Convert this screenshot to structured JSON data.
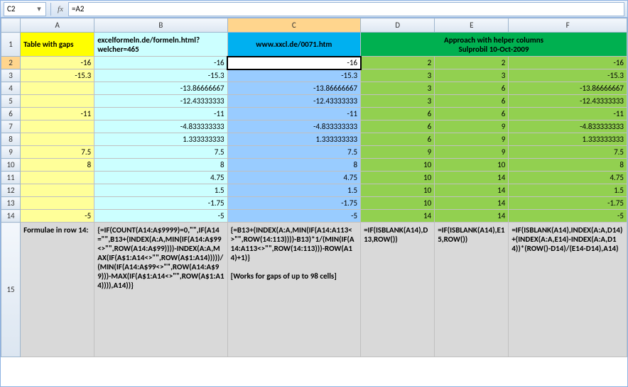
{
  "nameBox": "C2",
  "formula": "=A2",
  "fxLabel": "fx",
  "columns": [
    "A",
    "B",
    "C",
    "D",
    "E",
    "F"
  ],
  "rowNumbers": [
    1,
    2,
    3,
    4,
    5,
    6,
    7,
    8,
    9,
    10,
    11,
    12,
    13,
    14,
    15
  ],
  "selectedCell": "C2",
  "header": {
    "A": "Table with gaps",
    "B": "excelformeln.de/formeln.html?welcher=465",
    "C": "www.xxcl.de/0071.htm",
    "DEF1": "Approach with helper columns",
    "DEF2": "Sulprobil 10-Oct-2009"
  },
  "rows": [
    {
      "A": "-16",
      "B": "-16",
      "C": "-16",
      "D": "2",
      "E": "2",
      "F": "-16"
    },
    {
      "A": "-15.3",
      "B": "-15.3",
      "C": "-15.3",
      "D": "3",
      "E": "3",
      "F": "-15.3"
    },
    {
      "A": "",
      "B": "-13.86666667",
      "C": "-13.86666667",
      "D": "3",
      "E": "6",
      "F": "-13.86666667"
    },
    {
      "A": "",
      "B": "-12.43333333",
      "C": "-12.43333333",
      "D": "3",
      "E": "6",
      "F": "-12.43333333"
    },
    {
      "A": "-11",
      "B": "-11",
      "C": "-11",
      "D": "6",
      "E": "6",
      "F": "-11"
    },
    {
      "A": "",
      "B": "-4.833333333",
      "C": "-4.833333333",
      "D": "6",
      "E": "9",
      "F": "-4.833333333"
    },
    {
      "A": "",
      "B": "1.333333333",
      "C": "1.333333333",
      "D": "6",
      "E": "9",
      "F": "1.333333333"
    },
    {
      "A": "7.5",
      "B": "7.5",
      "C": "7.5",
      "D": "9",
      "E": "9",
      "F": "7.5"
    },
    {
      "A": "8",
      "B": "8",
      "C": "8",
      "D": "10",
      "E": "10",
      "F": "8"
    },
    {
      "A": "",
      "B": "4.75",
      "C": "4.75",
      "D": "10",
      "E": "14",
      "F": "4.75"
    },
    {
      "A": "",
      "B": "1.5",
      "C": "1.5",
      "D": "10",
      "E": "14",
      "F": "1.5"
    },
    {
      "A": "",
      "B": "-1.75",
      "C": "-1.75",
      "D": "10",
      "E": "14",
      "F": "-1.75"
    },
    {
      "A": "-5",
      "B": "-5",
      "C": "-5",
      "D": "14",
      "E": "14",
      "F": "-5"
    }
  ],
  "formulaeRow": {
    "A": "Formulae in row 14:",
    "B": "{=IF(COUNT(A14:A$9999)=0,\"\",IF(A14=\"\",B13+(INDEX(A:A,MIN(IF(A14:A$99<>\"\",ROW(A14:A$99))))-INDEX(A:A,MAX(IF(A$1:A14<>\"\",ROW(A$1:A14)))))/(MIN(IF(A14:A$99<>\"\",ROW(A14:A$99)))-MAX(IF(A$1:A14<>\"\",ROW(A$1:A14)))),A14))}",
    "C": "{=B13+(INDEX(A:A,MIN(IF(A14:A113<>\"\",ROW(14:113))))-B13)*1/(MIN(IF(A14:A113<>\"\",ROW(14:113)))-ROW(A14)+1)}\n\n[Works for gaps of up to 98 cells]",
    "D": "=IF(ISBLANK(A14),D13,ROW())",
    "E": "=IF(ISBLANK(A14),E15,ROW())",
    "F": "=IF(ISBLANK(A14),INDEX(A:A,D14)+(INDEX(A:A,E14)-INDEX(A:A,D14))*(ROW()-D14)/(E14-D14),A14)"
  }
}
